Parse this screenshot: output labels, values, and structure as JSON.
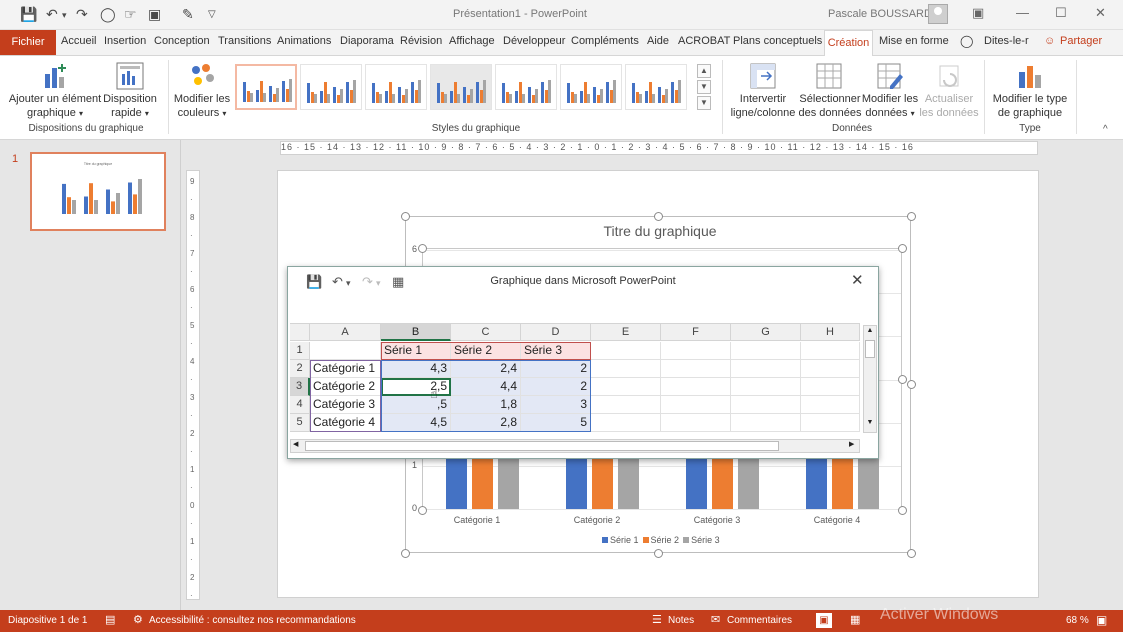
{
  "window": {
    "title": "Présentation1 - PowerPoint",
    "user": "Pascale BOUSSARD"
  },
  "tabs": {
    "fichier": "Fichier",
    "items": [
      "Accueil",
      "Insertion",
      "Conception",
      "Transitions",
      "Animations",
      "Diaporama",
      "Révision",
      "Affichage",
      "Développeur",
      "Compléments",
      "Aide",
      "ACROBAT",
      "Plans conceptuels"
    ],
    "active": "Création",
    "mise_en_forme": "Mise en forme",
    "tell_me": "Dites-le-r",
    "share": "Partager"
  },
  "ribbon": {
    "add_element_1": "Ajouter un élément",
    "add_element_2": "graphique",
    "quick_layout_1": "Disposition",
    "quick_layout_2": "rapide",
    "group_layouts": "Dispositions du graphique",
    "change_colors_1": "Modifier les",
    "change_colors_2": "couleurs",
    "group_styles": "Styles du graphique",
    "switch_1": "Intervertir",
    "switch_2": "ligne/colonne",
    "select_data_1": "Sélectionner",
    "select_data_2": "des données",
    "edit_data_1": "Modifier les",
    "edit_data_2": "données",
    "refresh_1": "Actualiser",
    "refresh_2": "les données",
    "group_data": "Données",
    "change_type_1": "Modifier le type",
    "change_type_2": "de graphique",
    "group_type": "Type"
  },
  "slides": {
    "current_number": "1"
  },
  "rulers": {
    "horizontal": "16 · 15 · 14 · 13 · 12 · 11 · 10 · 9 · 8 · 7 · 6 · 5 · 4 · 3 · 2 · 1 · 0 · 1 · 2 · 3 · 4 · 5 · 6 · 7 · 8 · 9 · 10 · 11 · 12 · 13 · 14 · 15 · 16"
  },
  "chart_data": {
    "type": "bar",
    "title": "Titre du graphique",
    "categories": [
      "Catégorie 1",
      "Catégorie 2",
      "Catégorie 3",
      "Catégorie 4"
    ],
    "series": [
      {
        "name": "Série 1",
        "values": [
          4.3,
          2.5,
          3.5,
          4.5
        ],
        "color": "#4472c4"
      },
      {
        "name": "Série 2",
        "values": [
          2.4,
          4.4,
          1.8,
          2.8
        ],
        "color": "#ed7d31"
      },
      {
        "name": "Série 3",
        "values": [
          2,
          2,
          3,
          5
        ],
        "color": "#a5a5a5"
      }
    ],
    "ylim": [
      0,
      6
    ],
    "yticks_visible": [
      "6",
      "1",
      "0"
    ],
    "legend": "bottom"
  },
  "dialog": {
    "title": "Graphique dans Microsoft PowerPoint",
    "columns": [
      "A",
      "B",
      "C",
      "D",
      "E",
      "F",
      "G",
      "H"
    ],
    "rows": [
      "1",
      "2",
      "3",
      "4",
      "5"
    ],
    "header": [
      "",
      "Série 1",
      "Série 2",
      "Série 3"
    ],
    "data": [
      [
        "Catégorie 1",
        "4,3",
        "2,4",
        "2"
      ],
      [
        "Catégorie 2",
        "2,5",
        "4,4",
        "2"
      ],
      [
        "Catégorie 3",
        "3,5",
        "1,8",
        "3"
      ],
      [
        "Catégorie 4",
        "4,5",
        "2,8",
        "5"
      ]
    ],
    "visible_r3_b": "2,5",
    "visible_r4_b": ",5"
  },
  "status": {
    "slide": "Diapositive 1 de 1",
    "accessibility": "Accessibilité : consultez nos recommandations",
    "notes": "Notes",
    "comments": "Commentaires",
    "zoom": "68 %",
    "watermark": "Activer Windows"
  }
}
